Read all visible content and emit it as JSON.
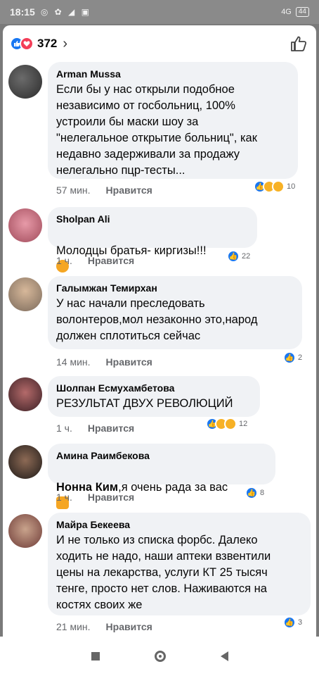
{
  "status_bar": {
    "time": "18:15",
    "signal": "4G",
    "battery": "44"
  },
  "header": {
    "reaction_count": "372",
    "chevron": "›"
  },
  "comments": [
    {
      "author": "Arman Mussa",
      "text": "Если бы у нас открыли подобное\nнезависимо от госбольниц, 100%\nустроили бы маски шоу за\n\"нелегальное открытие больниц\", как\nнедавно задерживали за продажу\nнелегально пцр-тесты...",
      "time": "57 мин.",
      "like_label": "Нравится",
      "reaction_count": "10",
      "reactions": [
        "like",
        "haha",
        "sad"
      ]
    },
    {
      "author": "Sholpan Ali",
      "text": "Молодцы братья- киргизы!!!",
      "time": "1 ч.",
      "like_label": "Нравится",
      "reaction_count": "22",
      "reactions": [
        "like"
      ]
    },
    {
      "author": "Галымжан Темирхан",
      "text": "У нас начали преследовать\nволонтеров,мол незаконно это,народ\nдолжен сплотиться сейчас",
      "time": "14 мин.",
      "like_label": "Нравится",
      "reaction_count": "2",
      "reactions": [
        "like"
      ]
    },
    {
      "author": "Шолпан Есмухамбетова",
      "text": "РЕЗУЛЬТАТ ДВУХ РЕВОЛЮЦИЙ",
      "time": "1 ч.",
      "like_label": "Нравится",
      "reaction_count": "12",
      "reactions": [
        "like",
        "wow",
        "sad"
      ]
    },
    {
      "author": "Амина Раимбекова",
      "mention": "Нонна Ким",
      "text": ",я очень рада за вас",
      "time": "1 ч.",
      "like_label": "Нравится",
      "reaction_count": "8",
      "reactions": [
        "like"
      ]
    },
    {
      "author": "Майра Бекеева",
      "text": "И не только из списка форбс. Далеко\nходить не надо, наши аптеки взвентили\nцены на лекарства, услуги КТ 25 тысяч\nтенге, просто нет слов. Наживаются на\nкостях своих же",
      "time": "21 мин.",
      "like_label": "Нравится",
      "reaction_count": "3",
      "reactions": [
        "like"
      ]
    }
  ],
  "colors": {
    "like": "#1877f2",
    "love": "#f33e58",
    "yellow": "#f7b125",
    "bubble": "#f0f2f5",
    "meta": "#65676b"
  },
  "icons": [
    "like-icon",
    "love-icon",
    "thumbs-up-outline-icon",
    "chevron-right-icon",
    "nav-recents-icon",
    "nav-home-icon",
    "nav-back-icon"
  ]
}
